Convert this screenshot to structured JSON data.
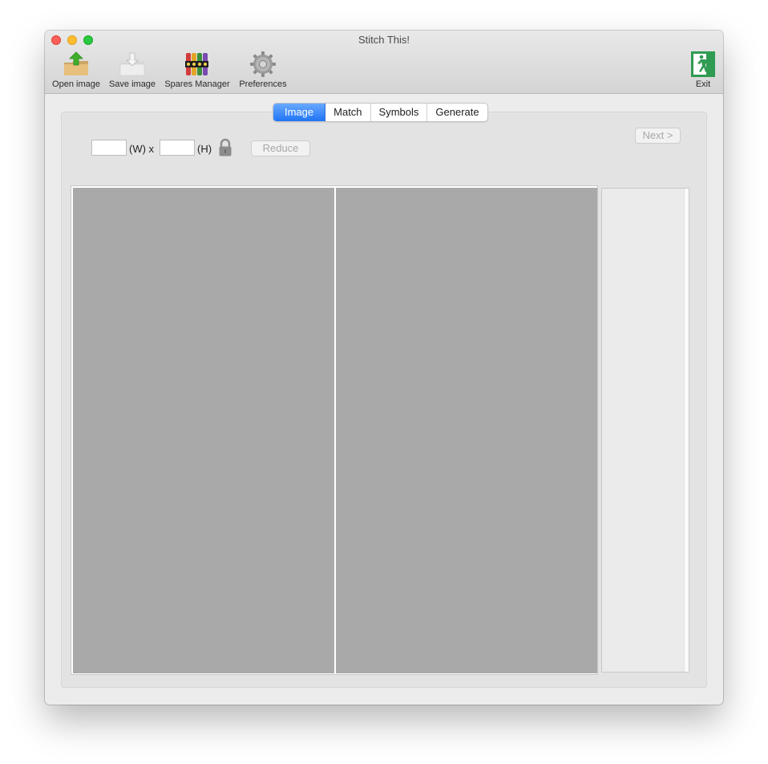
{
  "window": {
    "title": "Stitch This!"
  },
  "toolbar": {
    "open_label": "Open image",
    "save_label": "Save image",
    "spares_label": "Spares Manager",
    "preferences_label": "Preferences",
    "exit_label": "Exit"
  },
  "tabs": [
    {
      "label": "Image",
      "selected": true
    },
    {
      "label": "Match",
      "selected": false
    },
    {
      "label": "Symbols",
      "selected": false
    },
    {
      "label": "Generate",
      "selected": false
    }
  ],
  "size": {
    "width_value": "",
    "height_value": "",
    "width_suffix": "(W) x",
    "height_suffix": "(H)",
    "lock_icon": "lock-icon"
  },
  "buttons": {
    "reduce_label": "Reduce",
    "next_label": "Next >"
  },
  "colors": {
    "accent": "#1f74f4",
    "pane": "#a9a9a9",
    "traffic_close": "#fe5f57",
    "traffic_minimize": "#febc2e",
    "traffic_maximize": "#28c840"
  }
}
